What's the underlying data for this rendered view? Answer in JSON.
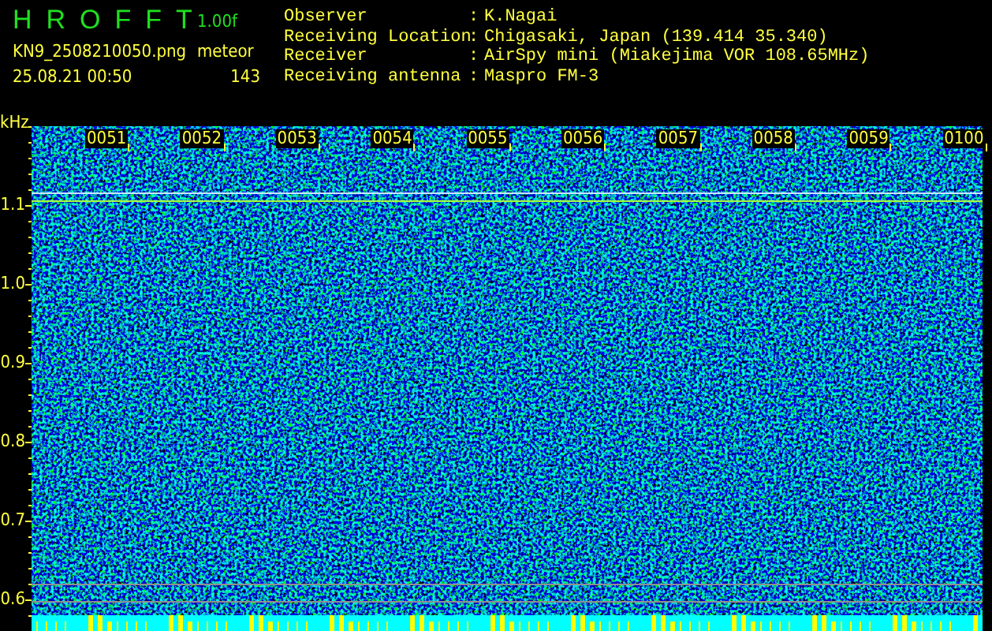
{
  "header": {
    "title": "HROFFT",
    "version": "1.00f",
    "filename": "KN9_2508210050.png",
    "datetime": "25.08.21 00:50",
    "meteor_label": "meteor",
    "meteor_count": "143",
    "info": [
      {
        "label": "Observer",
        "separator": ":",
        "value": "K.Nagai"
      },
      {
        "label": "Receiving Location",
        "separator": ":",
        "value": "Chigasaki, Japan (139.414 35.340)"
      },
      {
        "label": "Receiver",
        "separator": ":",
        "value": "AirSpy mini (Miakejima VOR 108.65MHz)"
      },
      {
        "label": "Receiving antenna",
        "separator": ":",
        "value": "Maspro FM-3"
      }
    ]
  },
  "plot": {
    "y_unit": "kHz",
    "y_ticks": [
      "1.1",
      "1.0",
      "0.9",
      "0.8",
      "0.7",
      "0.6"
    ],
    "time_labels": [
      "0051",
      "0052",
      "0053",
      "0054",
      "0055",
      "0056",
      "0057",
      "0058",
      "0059",
      "0100"
    ]
  }
}
